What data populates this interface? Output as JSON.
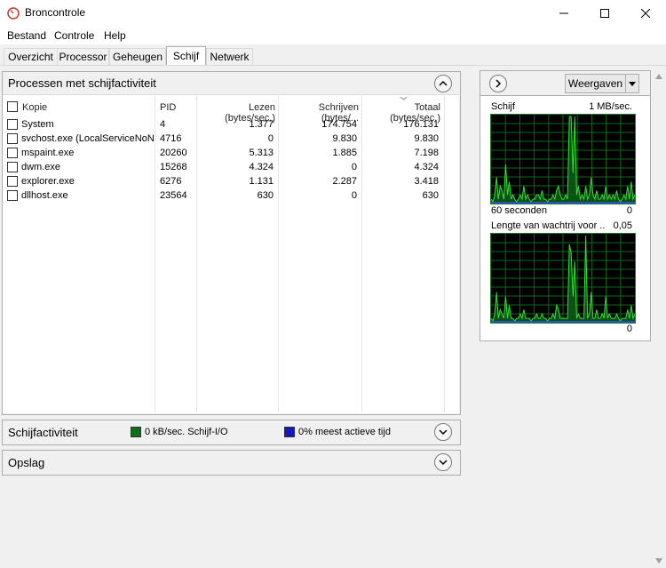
{
  "window": {
    "title": "Broncontrole"
  },
  "window_controls": {
    "minimize": "─",
    "maximize": "☐",
    "close": "✕"
  },
  "menu": [
    "Bestand",
    "Controle",
    "Help"
  ],
  "tabs": [
    "Overzicht",
    "Processor",
    "Geheugen",
    "Schijf",
    "Netwerk"
  ],
  "active_tab": "Schijf",
  "processes_section": {
    "title": "Processen met schijfactiviteit",
    "columns": [
      "Kopie",
      "PID",
      "Lezen (bytes/sec.)",
      "Schrijven (bytes/...",
      "Totaal (bytes/sec.)"
    ],
    "rows": [
      {
        "image": "System",
        "pid": "4",
        "read": "1.377",
        "write": "174.754",
        "total": "176.131"
      },
      {
        "image": "svchost.exe (LocalServiceNoNet...",
        "pid": "4716",
        "read": "0",
        "write": "9.830",
        "total": "9.830"
      },
      {
        "image": "mspaint.exe",
        "pid": "20260",
        "read": "5.313",
        "write": "1.885",
        "total": "7.198"
      },
      {
        "image": "dwm.exe",
        "pid": "15268",
        "read": "4.324",
        "write": "0",
        "total": "4.324"
      },
      {
        "image": "explorer.exe",
        "pid": "6276",
        "read": "1.131",
        "write": "2.287",
        "total": "3.418"
      },
      {
        "image": "dllhost.exe",
        "pid": "23564",
        "read": "630",
        "write": "0",
        "total": "630"
      }
    ]
  },
  "disk_activity_section": {
    "title": "Schijfactiviteit",
    "io_text": "0 kB/sec. Schijf-I/O",
    "active_text": "0% meest actieve tijd",
    "io_color": "#0f6e1a",
    "active_color": "#1616c8"
  },
  "storage_section": {
    "title": "Opslag"
  },
  "right_panel": {
    "views_label": "Weergaven",
    "graph1": {
      "title": "Schijf",
      "scale": "1 MB/sec.",
      "bottom_left": "60 seconden",
      "bottom_right": "0",
      "values": [
        0.05,
        0.02,
        0.1,
        0.3,
        0.05,
        0.2,
        0.15,
        0.05,
        0.45,
        0.1,
        0.25,
        0.05,
        0.1,
        0.05,
        0.02,
        0.05,
        0.1,
        0.05,
        0.2,
        0.05,
        0.1,
        0.05,
        0.02,
        0.05,
        0.05,
        0.1,
        0.1,
        0.05,
        0.15,
        0.05,
        0.05,
        0.02,
        0.05,
        0.05,
        0.1,
        0.05,
        0.15,
        0.2,
        0.1,
        0.05,
        0.05,
        0.1,
        0.05,
        1.0,
        1.0,
        0.35,
        1.0,
        0.1,
        0.2,
        0.05,
        0.1,
        0.05,
        0.2,
        0.05,
        0.1,
        0.3,
        0.1,
        0.05,
        0.15,
        0.05,
        0.05,
        0.1,
        0.05,
        0.2,
        0.05,
        0.1,
        0.05,
        0.1,
        0.05,
        0.15,
        0.05,
        0.02,
        0.05,
        0.1,
        0.05,
        0.2,
        0.05,
        0.25,
        0.05,
        0.1
      ]
    },
    "graph2": {
      "title": "Lengte van wachtrij voor ...",
      "scale": "0,05",
      "bottom_right": "0",
      "values": [
        0.05,
        0.02,
        0.1,
        0.35,
        0.05,
        0.15,
        0.1,
        0.05,
        0.3,
        0.05,
        0.2,
        0.05,
        0.05,
        0.02,
        0.05,
        0.05,
        0.1,
        0.05,
        0.15,
        0.05,
        0.05,
        0.05,
        0.02,
        0.05,
        0.05,
        0.1,
        0.05,
        0.05,
        0.1,
        0.05,
        0.05,
        0.02,
        0.05,
        0.05,
        0.1,
        0.05,
        0.2,
        0.15,
        0.05,
        0.05,
        0.05,
        0.05,
        0.05,
        0.9,
        0.8,
        0.3,
        0.7,
        0.05,
        0.1,
        0.05,
        0.05,
        0.05,
        1.0,
        0.05,
        0.1,
        0.35,
        0.05,
        0.05,
        0.15,
        0.05,
        0.05,
        0.1,
        0.05,
        0.3,
        0.05,
        0.1,
        0.05,
        0.05,
        0.05,
        0.1,
        0.05,
        0.02,
        0.05,
        0.05,
        0.05,
        0.15,
        0.05,
        0.2,
        0.05,
        0.1
      ]
    }
  },
  "colors": {
    "graph_line": "#33e033",
    "graph_fill": "#0b5a14",
    "graph_grid": "#0a6a16",
    "graph_blue": "#3050ff"
  }
}
